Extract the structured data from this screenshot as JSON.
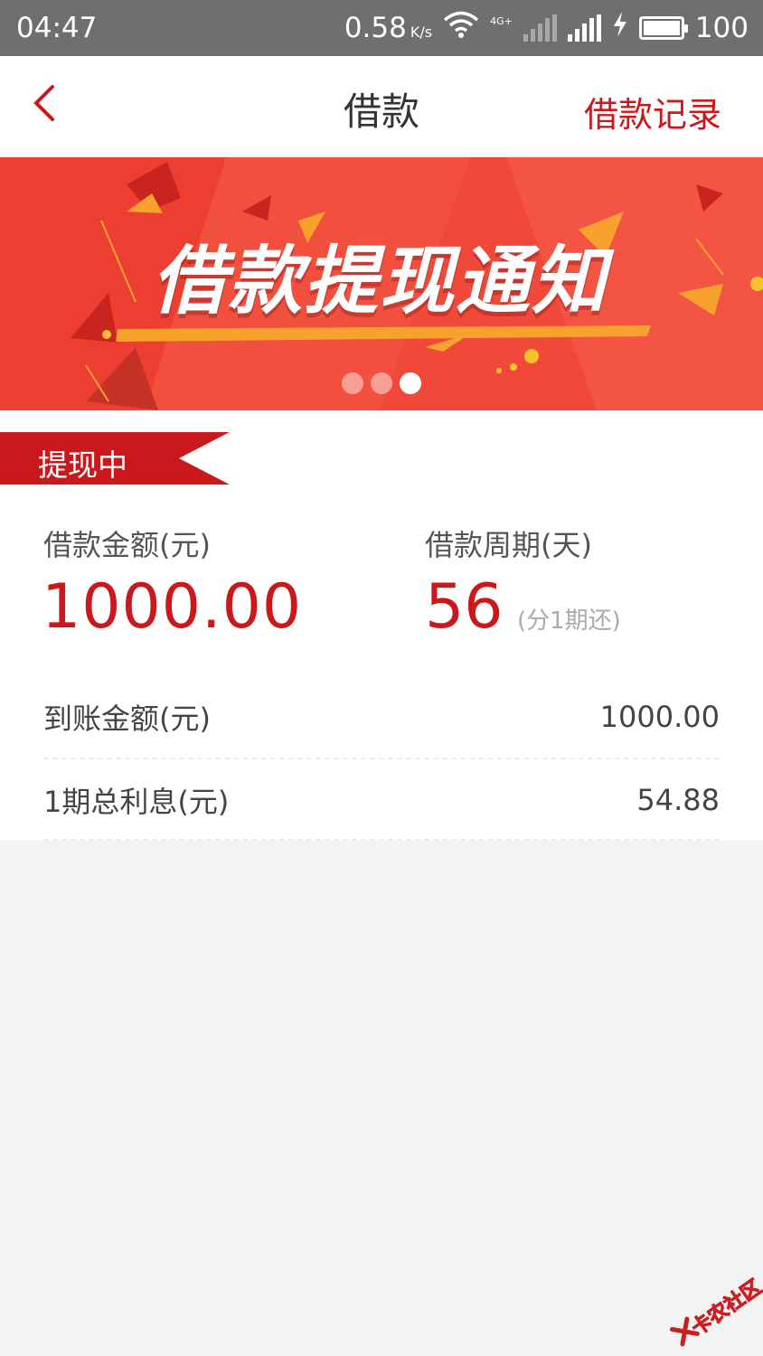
{
  "status_bar": {
    "time": "04:47",
    "speed": "0.58",
    "speed_unit": "K/s",
    "network_tag": "4G+",
    "battery": "100"
  },
  "header": {
    "title": "借款",
    "records_label": "借款记录"
  },
  "banner": {
    "title": "借款提现通知",
    "dots_count": 3,
    "active_dot": 3
  },
  "status": {
    "label": "提现中"
  },
  "loan": {
    "amount_label": "借款金额(元)",
    "amount_value": "1000.00",
    "period_label": "借款周期(天)",
    "period_value": "56",
    "installment_note": "(分1期还)"
  },
  "details": [
    {
      "label": "到账金额(元)",
      "value": "1000.00"
    },
    {
      "label": "1期总利息(元)",
      "value": "54.88"
    }
  ],
  "watermark": {
    "text": "卡农社区"
  },
  "colors": {
    "accent": "#c9191c",
    "banner_base": "#f0493a",
    "page_bg": "#f3f3f3"
  }
}
